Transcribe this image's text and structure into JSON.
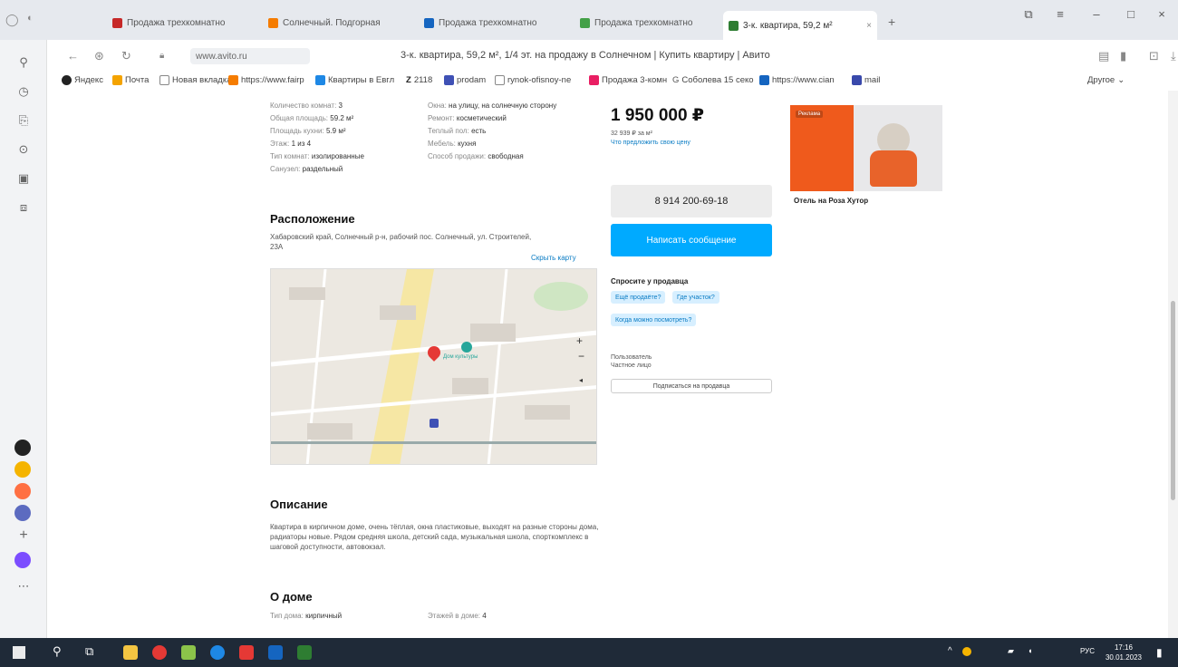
{
  "browser": {
    "tabs": [
      {
        "label": "Продажа трехкомнатно",
        "color": "#c62828"
      },
      {
        "label": "Солнечный. Подгорная",
        "color": "#f57c00"
      },
      {
        "label": "Продажа трехкомнатно",
        "color": "#1565c0"
      },
      {
        "label": "Продажа трехкомнатно",
        "color": "#43a047"
      },
      {
        "label": "3-к. квартира, 59,2 м²",
        "color": "#2e7d32"
      }
    ],
    "new_tab": "+",
    "url": "www.avito.ru",
    "page_title": "3-к. квартира, 59,2 м², 1/4 эт. на продажу в Солнечном | Купить квартиру | Авито",
    "bookmarks": [
      "Яндекс",
      "Почта",
      "Новая вкладка",
      "https://www.fairp",
      "Квартиры в Евгл",
      "2118",
      "prodam",
      "rynok-ofisnoy-ne",
      "Продажа 3-комн",
      "Соболева 15 секо",
      "https://www.cian",
      "mail"
    ],
    "bookmarks_more": "Другое"
  },
  "specs_left": [
    {
      "label": "Количество комнат:",
      "value": "3"
    },
    {
      "label": "Общая площадь:",
      "value": "59.2 м²"
    },
    {
      "label": "Площадь кухни:",
      "value": "5.9 м²"
    },
    {
      "label": "Этаж:",
      "value": "1 из 4"
    },
    {
      "label": "Тип комнат:",
      "value": "изолированные"
    },
    {
      "label": "Санузел:",
      "value": "раздельный"
    }
  ],
  "specs_right": [
    {
      "label": "Окна:",
      "value": "на улицу, на солнечную сторону"
    },
    {
      "label": "Ремонт:",
      "value": "косметический"
    },
    {
      "label": "Теплый пол:",
      "value": "есть"
    },
    {
      "label": "Мебель:",
      "value": "кухня"
    },
    {
      "label": "Способ продажи:",
      "value": "свободная"
    }
  ],
  "location": {
    "heading": "Расположение",
    "address": "Хабаровский край, Солнечный р-н, рабочий пос. Солнечный, ул. Строителей, 23А",
    "hide_map": "Скрыть карту"
  },
  "description": {
    "heading": "Описание",
    "text": "Квартира в кирпичном доме, очень тёплая, окна пластиковые, выходят на разные стороны дома, радиаторы новые. Рядом средняя школа, детский сада, музыкальная школа, спорткомплекс в шаговой доступности, автовокзал."
  },
  "house": {
    "heading": "О доме",
    "type_label": "Тип дома:",
    "type_value": "кирпичный",
    "floors_label": "Этажей в доме:",
    "floors_value": "4"
  },
  "seller": {
    "price": "1 950 000 ₽",
    "price_per_m": "32 939 ₽ за м²",
    "price_link": "Что предложить свою цену",
    "phone": "8 914 200-69-18",
    "message": "Написать сообщение",
    "ask_heading": "Спросите у продавца",
    "ask_chips": [
      "Ещё продаёте?",
      "Где участок?",
      "Когда можно посмотреть?"
    ],
    "user_type": "Пользователь",
    "user_kind": "Частное лицо",
    "subscribe": "Подписаться на продавца"
  },
  "ad": {
    "caption": "Отель на Роза Хутор",
    "badge": "Реклама"
  },
  "map": {
    "zoom_in": "+",
    "zoom_out": "−",
    "poi_label": "Дом культуры"
  },
  "taskbar": {
    "time": "17:16",
    "date": "30.01.2023",
    "lang": "РУС"
  },
  "colors": {
    "accent": "#00aaff",
    "marker": "#e53935"
  }
}
